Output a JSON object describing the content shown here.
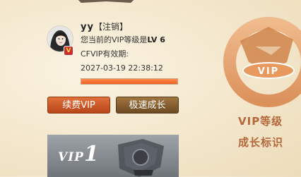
{
  "user": {
    "name": "yy",
    "logout_label": "【注销】",
    "level_prefix": "您当前的VIP等级是",
    "level_value": "LV 6",
    "expiry_label": "CFVIP有效期:",
    "expiry_datetime": "2027-03-19 22:38:12",
    "badge_icon": "vip-badge-icon",
    "progress_fraction": 1.0
  },
  "buttons": {
    "renew_label": "续费VIP",
    "speed_label": "极速成长"
  },
  "vip_card": {
    "vip_word": "VIP",
    "vip_num": "1"
  },
  "sidebar": {
    "emblem_text": "VIP",
    "title": "VIP等级",
    "subtitle": "成长标识"
  },
  "colors": {
    "renew_button": "#c8582a",
    "speed_button": "#845c2e",
    "progress_fill": "#f06828",
    "side_text": "#b3683c"
  }
}
